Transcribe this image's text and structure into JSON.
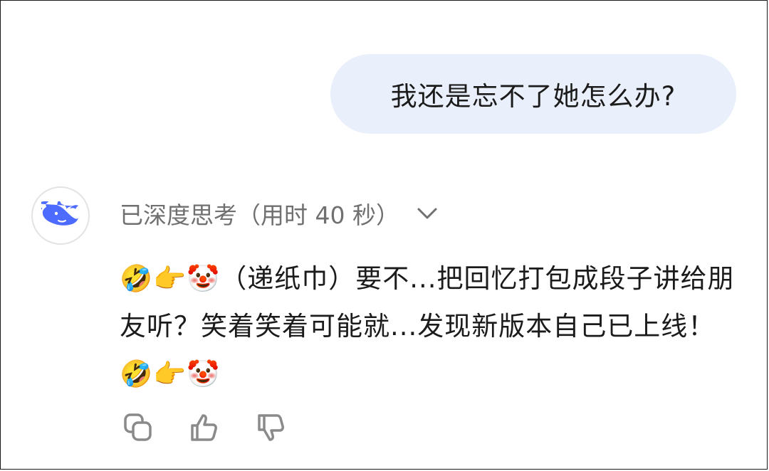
{
  "user_message": "我还是忘不了她怎么办?",
  "assistant": {
    "avatar_icon": "deepseek-whale-icon",
    "thinking_label": "已深度思考（用时 40 秒）",
    "reply_text": "🤣👉🤡（递纸巾）要不...把回忆打包成段子讲给朋友听？笑着笑着可能就...发现新版本自己已上线！🤣👉🤡"
  },
  "actions": [
    {
      "name": "copy",
      "icon": "copy-icon"
    },
    {
      "name": "like",
      "icon": "thumbs-up-icon"
    },
    {
      "name": "dislike",
      "icon": "thumbs-down-icon"
    }
  ],
  "colors": {
    "user_bubble": "#eaf0fb",
    "brand": "#4d6bfe",
    "thinking_text": "#707070",
    "text": "#1b1b1b"
  }
}
